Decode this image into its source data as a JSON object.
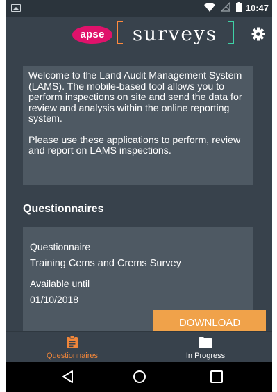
{
  "status_bar": {
    "time": "10:47",
    "icons": [
      "image-icon",
      "wifi-icon",
      "no-signal-icon",
      "battery-icon"
    ]
  },
  "header": {
    "logo_apse": "apse",
    "logo_surveys": "surveys",
    "settings_icon": "gear-icon"
  },
  "welcome": {
    "paragraph1": "Welcome to the Land Audit Management System (LAMS).  The mobile-based tool allows you to perform inspections on site and send the data for review and analysis within the online reporting system.",
    "paragraph2": "Please use these applications to perform, review and report on LAMS inspections."
  },
  "questionnaires": {
    "title": "Questionnaires",
    "items": [
      {
        "questionnaire_label": "Questionnaire",
        "name": "Training Cems and Crems Survey",
        "available_label": "Available until",
        "available_date": "01/10/2018",
        "download_label": "DOWNLOAD"
      }
    ]
  },
  "tabs": [
    {
      "label": "Questionnaires",
      "icon": "clipboard-icon",
      "active": true
    },
    {
      "label": "In Progress",
      "icon": "folder-icon",
      "active": false
    }
  ],
  "nav": [
    "back-icon",
    "home-icon",
    "recents-icon"
  ],
  "colors": {
    "background": "#38424c",
    "card": "#4e5963",
    "accent_orange": "#f0863a",
    "download_button": "#f0a24a",
    "apse_pink": "#e0126b"
  }
}
